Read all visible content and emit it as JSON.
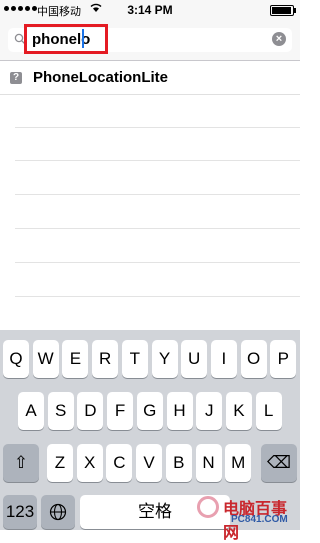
{
  "status_bar": {
    "carrier": "中国移动",
    "time": "3:14 PM"
  },
  "search": {
    "query": "phonelo",
    "clear_glyph": "×"
  },
  "results": [
    {
      "label": "PhoneLocationLite",
      "icon": "question-mark-icon",
      "icon_glyph": "?"
    }
  ],
  "keyboard": {
    "row1": [
      "Q",
      "W",
      "E",
      "R",
      "T",
      "Y",
      "U",
      "I",
      "O",
      "P"
    ],
    "row2": [
      "A",
      "S",
      "D",
      "F",
      "G",
      "H",
      "J",
      "K",
      "L"
    ],
    "row3": [
      "Z",
      "X",
      "C",
      "V",
      "B",
      "N",
      "M"
    ],
    "numbers_key": "123",
    "space_key": "空格",
    "shift_glyph": "⇧",
    "delete_glyph": "⌫"
  },
  "watermark": {
    "text": "电脑百事网",
    "sub": "PC841.COM"
  },
  "colors": {
    "highlight": "#e41b23",
    "caret": "#1a73e8",
    "keyboard_bg": "#d1d4d9"
  }
}
